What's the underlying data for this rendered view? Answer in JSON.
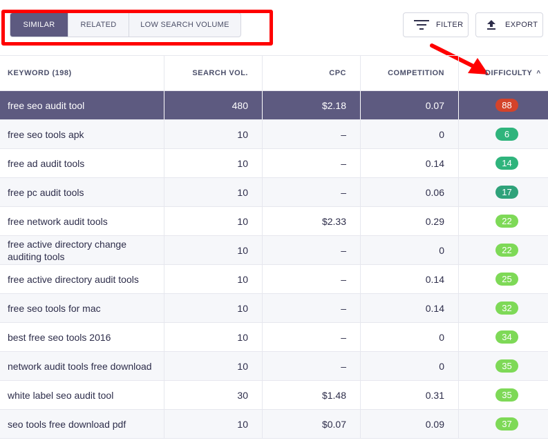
{
  "tabs": [
    {
      "label": "SIMILAR",
      "active": true
    },
    {
      "label": "RELATED",
      "active": false
    },
    {
      "label": "LOW SEARCH VOLUME",
      "active": false
    }
  ],
  "toolbar": {
    "filter_label": "FILTER",
    "export_label": "EXPORT"
  },
  "table": {
    "headers": {
      "keyword": "KEYWORD  (198)",
      "search_vol": "SEARCH VOL.",
      "cpc": "CPC",
      "competition": "COMPETITION",
      "difficulty": "DIFFICULTY",
      "sort_caret": "^"
    },
    "rows": [
      {
        "keyword": "free seo audit tool",
        "vol": "480",
        "cpc": "$2.18",
        "comp": "0.07",
        "diff": "88",
        "color": "#d4432a",
        "selected": true
      },
      {
        "keyword": "free seo tools apk",
        "vol": "10",
        "cpc": "–",
        "comp": "0",
        "diff": "6",
        "color": "#2fb47c"
      },
      {
        "keyword": "free ad audit tools",
        "vol": "10",
        "cpc": "–",
        "comp": "0.14",
        "diff": "14",
        "color": "#2fb47c"
      },
      {
        "keyword": "free pc audit tools",
        "vol": "10",
        "cpc": "–",
        "comp": "0.06",
        "diff": "17",
        "color": "#2fa27a"
      },
      {
        "keyword": "free network audit tools",
        "vol": "10",
        "cpc": "$2.33",
        "comp": "0.29",
        "diff": "22",
        "color": "#7ed957"
      },
      {
        "keyword": "free active directory change auditing tools",
        "vol": "10",
        "cpc": "–",
        "comp": "0",
        "diff": "22",
        "color": "#7ed957"
      },
      {
        "keyword": "free active directory audit tools",
        "vol": "10",
        "cpc": "–",
        "comp": "0.14",
        "diff": "25",
        "color": "#7ed957"
      },
      {
        "keyword": "free seo tools for mac",
        "vol": "10",
        "cpc": "–",
        "comp": "0.14",
        "diff": "32",
        "color": "#7ed957"
      },
      {
        "keyword": "best free seo tools 2016",
        "vol": "10",
        "cpc": "–",
        "comp": "0",
        "diff": "34",
        "color": "#7ed957"
      },
      {
        "keyword": "network audit tools free download",
        "vol": "10",
        "cpc": "–",
        "comp": "0",
        "diff": "35",
        "color": "#7ed957"
      },
      {
        "keyword": "white label seo audit tool",
        "vol": "30",
        "cpc": "$1.48",
        "comp": "0.31",
        "diff": "35",
        "color": "#7ed957"
      },
      {
        "keyword": "seo tools free download pdf",
        "vol": "10",
        "cpc": "$0.07",
        "comp": "0.09",
        "diff": "37",
        "color": "#7ed957"
      }
    ]
  },
  "colors": {
    "accent": "#5d5a80",
    "annotation": "#ff0000"
  }
}
